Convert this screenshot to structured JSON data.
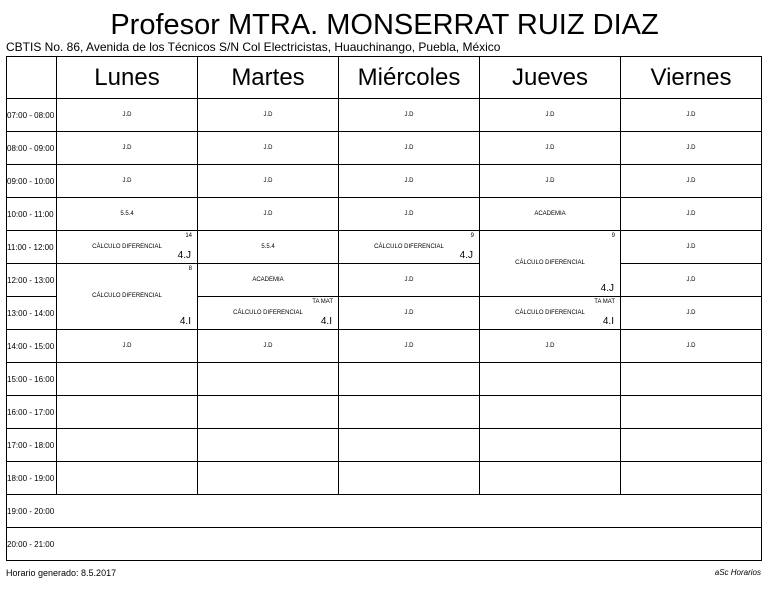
{
  "title": "Profesor MTRA. MONSERRAT RUIZ DIAZ",
  "subtitle": "CBTIS No. 86, Avenida de los Técnicos S/N Col Electricistas, Huauchinango, Puebla, México",
  "days": [
    "Lunes",
    "Martes",
    "Miércoles",
    "Jueves",
    "Viernes"
  ],
  "times": [
    "07:00 - 08:00",
    "08:00 - 09:00",
    "09:00 - 10:00",
    "10:00 - 11:00",
    "11:00 - 12:00",
    "12:00 - 13:00",
    "13:00 - 14:00",
    "14:00 - 15:00",
    "15:00 - 16:00",
    "16:00 - 17:00",
    "17:00 - 18:00",
    "18:00 - 19:00",
    "19:00 - 20:00",
    "20:00 - 21:00"
  ],
  "jd": "J.D",
  "academia": "ACADEMIA",
  "code554": "5.5.4",
  "calculo": "CÁLCULO DIFERENCIAL",
  "lesson_lunes_11": {
    "room": "14",
    "group": "4.J"
  },
  "lesson_lunes_12": {
    "room": "8",
    "group": "4.I"
  },
  "lesson_martes_13": {
    "room": "TA MAT",
    "group": "4.I"
  },
  "lesson_miercoles_11": {
    "room": "9",
    "group": "4.J"
  },
  "lesson_jueves_11": {
    "room": "9",
    "group": "4.J"
  },
  "lesson_jueves_13": {
    "room": "TA MAT",
    "group": "4.I"
  },
  "footer_left": "Horario generado: 8.5.2017",
  "footer_right": "aSc Horarios"
}
